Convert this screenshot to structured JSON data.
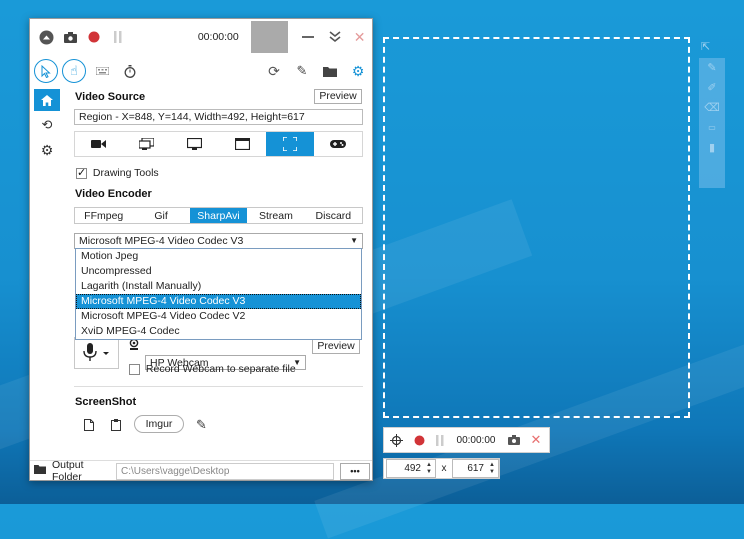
{
  "title_bar": {
    "timer": "00:00:00"
  },
  "video_source": {
    "title": "Video Source",
    "preview_label": "Preview",
    "region_text": "Region  -  X=848, Y=144, Width=492, Height=617",
    "selected_source": "region"
  },
  "drawing_tools": {
    "label": "Drawing Tools",
    "checked": true
  },
  "video_encoder": {
    "title": "Video Encoder",
    "tabs": [
      "FFmpeg",
      "Gif",
      "SharpAvi",
      "Stream",
      "Discard"
    ],
    "selected_tab": "SharpAvi",
    "codec_selected": "Microsoft MPEG-4 Video Codec V3",
    "codec_options": [
      "Motion Jpeg",
      "Uncompressed",
      "Lagarith (Install Manually)",
      "Microsoft MPEG-4 Video Codec V3",
      "Microsoft MPEG-4 Video Codec V2",
      "XviD MPEG-4 Codec"
    ]
  },
  "webcam": {
    "device": "HP Webcam",
    "preview_label": "Preview",
    "separate_label": "Record Webcam to separate file",
    "separate_checked": false
  },
  "screenshot": {
    "title": "ScreenShot",
    "imgur_label": "Imgur"
  },
  "footer": {
    "label": "Output Folder",
    "path": "C:\\Users\\vagge\\Desktop",
    "more_label": "•••"
  },
  "region_bar": {
    "timer": "00:00:00",
    "width": "492",
    "height": "617",
    "separator": "x"
  },
  "colors": {
    "accent": "#1592d6",
    "record": "#d13438"
  }
}
